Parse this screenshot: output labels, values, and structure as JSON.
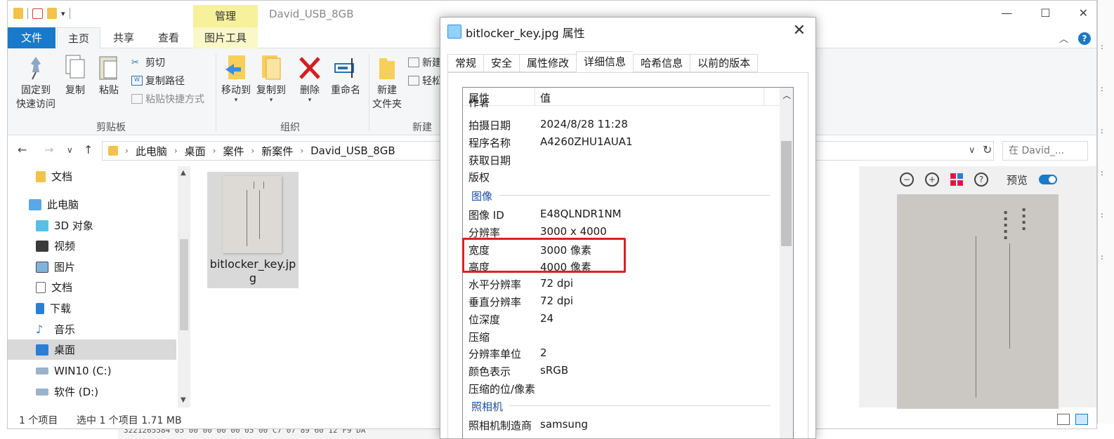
{
  "explorer": {
    "window_title": "David_USB_8GB",
    "manage_tab": "管理",
    "tabs": {
      "file": "文件",
      "home": "主页",
      "share": "共享",
      "view": "查看",
      "picture_tools": "图片工具"
    },
    "ribbon": {
      "pin": [
        "固定到",
        "快速访问"
      ],
      "copy": "复制",
      "paste": "粘贴",
      "cut": "剪切",
      "copy_path": "复制路径",
      "paste_shortcut": "粘贴快捷方式",
      "clipboard_group": "剪贴板",
      "move_to": "移动到",
      "copy_to": "复制到",
      "delete": "删除",
      "rename": "重命名",
      "organize_group": "组织",
      "new_folder": [
        "新建",
        "文件夹"
      ],
      "new_item": "新建",
      "easy_access": "轻松",
      "new_group": "新建"
    },
    "address": {
      "crumbs": [
        "此电脑",
        "桌面",
        "案件",
        "新案件",
        "David_USB_8GB"
      ],
      "search_placeholder": "在 David_..."
    },
    "nav": [
      {
        "label": "文档",
        "icon": "folder-icon"
      },
      {
        "label": "此电脑",
        "icon": "computer-icon"
      },
      {
        "label": "3D 对象",
        "icon": "cube-icon"
      },
      {
        "label": "视频",
        "icon": "video-icon"
      },
      {
        "label": "图片",
        "icon": "picture-icon"
      },
      {
        "label": "文档",
        "icon": "document-icon"
      },
      {
        "label": "下载",
        "icon": "download-icon"
      },
      {
        "label": "音乐",
        "icon": "music-icon"
      },
      {
        "label": "桌面",
        "icon": "desktop-icon"
      },
      {
        "label": "WIN10 (C:)",
        "icon": "drive-icon"
      },
      {
        "label": "软件 (D:)",
        "icon": "drive-icon"
      }
    ],
    "file": {
      "name": "bitlocker_key.jpg"
    },
    "preview": {
      "label": "预览"
    },
    "status": {
      "count": "1 个项目",
      "selected": "选中 1 个项目  1.71 MB"
    }
  },
  "dialog": {
    "title": "bitlocker_key.jpg 属性",
    "tabs": [
      "常规",
      "安全",
      "属性修改",
      "详细信息",
      "哈希信息",
      "以前的版本"
    ],
    "active_tab": "详细信息",
    "columns": {
      "property": "属性",
      "value": "值"
    },
    "rows_top": [
      {
        "k": "拍摄日期",
        "v": "2024/8/28 11:28"
      },
      {
        "k": "程序名称",
        "v": "A4260ZHU1AUA1"
      },
      {
        "k": "获取日期",
        "v": ""
      },
      {
        "k": "版权",
        "v": ""
      }
    ],
    "section_image": "图像",
    "rows_image": [
      {
        "k": "图像 ID",
        "v": "E48QLNDR1NM"
      },
      {
        "k": "分辨率",
        "v": "3000 x 4000"
      },
      {
        "k": "宽度",
        "v": "3000 像素"
      },
      {
        "k": "高度",
        "v": "4000 像素"
      },
      {
        "k": "水平分辨率",
        "v": "72 dpi"
      },
      {
        "k": "垂直分辨率",
        "v": "72 dpi"
      },
      {
        "k": "位深度",
        "v": "24"
      },
      {
        "k": "压缩",
        "v": ""
      },
      {
        "k": "分辨率单位",
        "v": "2"
      },
      {
        "k": "颜色表示",
        "v": "sRGB"
      },
      {
        "k": "压缩的位/像素",
        "v": ""
      }
    ],
    "section_camera": "照相机",
    "rows_camera": [
      {
        "k": "照相机制造商",
        "v": "samsung"
      }
    ],
    "partial_row": "作者"
  },
  "background": {
    "hex_line": "3221265584  05 00 00 00 00 05 00  C7 07 89 60 12 F9 DA"
  },
  "colors": {
    "accent": "#1979ca",
    "highlight": "#e02020",
    "manage": "#f6f19a"
  }
}
